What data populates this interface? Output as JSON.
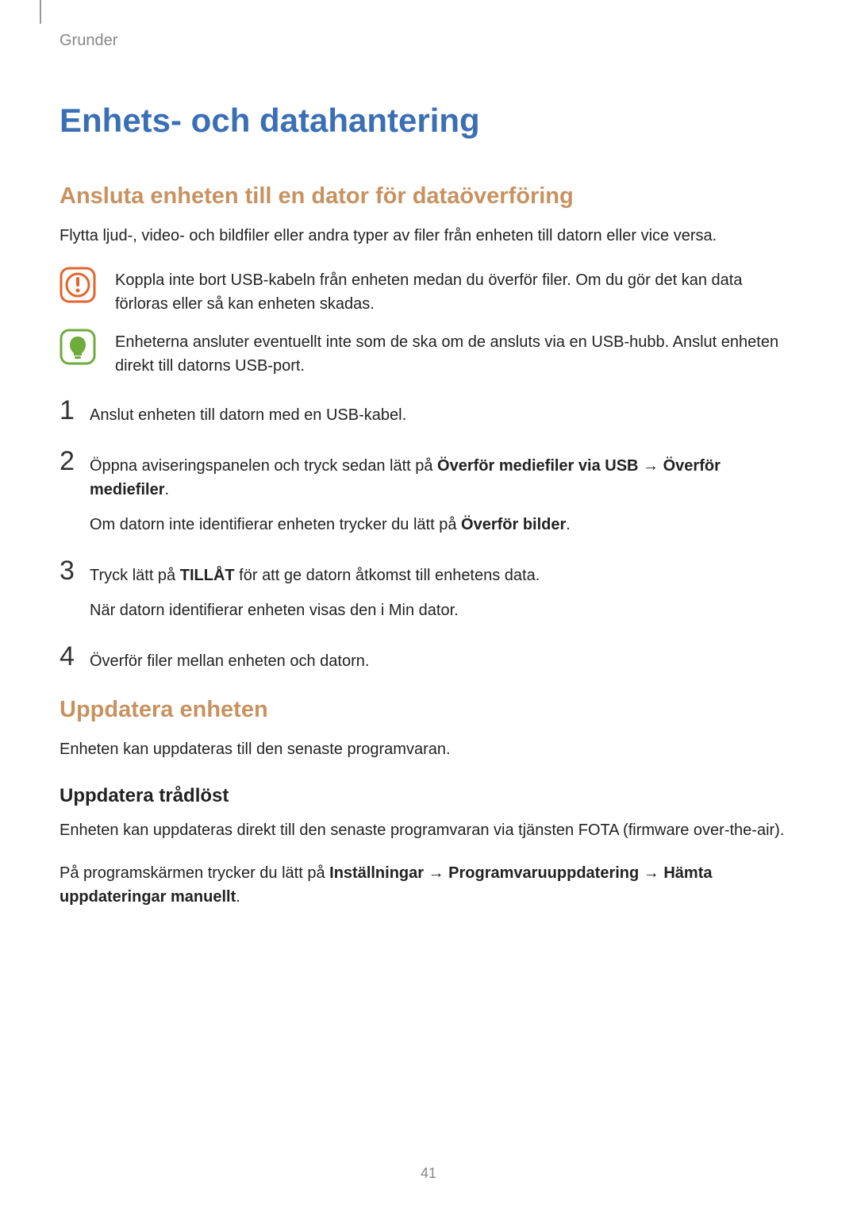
{
  "breadcrumb": "Grunder",
  "h1": "Enhets- och datahantering",
  "section1": {
    "title": "Ansluta enheten till en dator för dataöverföring",
    "intro": "Flytta ljud-, video- och bildfiler eller andra typer av filer från enheten till datorn eller vice versa.",
    "alert_warning": "Koppla inte bort USB-kabeln från enheten medan du överför filer. Om du gör det kan data förloras eller så kan enheten skadas.",
    "alert_info": "Enheterna ansluter eventuellt inte som de ska om de ansluts via en USB-hubb. Anslut enheten direkt till datorns USB-port.",
    "steps": {
      "n1": "1",
      "s1": "Anslut enheten till datorn med en USB-kabel.",
      "n2": "2",
      "s2_a": "Öppna aviseringspanelen och tryck sedan lätt på ",
      "s2_b": "Överför mediefiler via USB",
      "s2_arrow": " → ",
      "s2_c": "Överför mediefiler",
      "s2_d": ".",
      "s2_sub_a": "Om datorn inte identifierar enheten trycker du lätt på ",
      "s2_sub_b": "Överför bilder",
      "s2_sub_c": ".",
      "n3": "3",
      "s3_a": "Tryck lätt på ",
      "s3_b": "TILLÅT",
      "s3_c": " för att ge datorn åtkomst till enhetens data.",
      "s3_sub": "När datorn identifierar enheten visas den i Min dator.",
      "n4": "4",
      "s4": "Överför filer mellan enheten och datorn."
    }
  },
  "section2": {
    "title": "Uppdatera enheten",
    "intro": "Enheten kan uppdateras till den senaste programvaran.",
    "sub_title": "Uppdatera trådlöst",
    "p1": "Enheten kan uppdateras direkt till den senaste programvaran via tjänsten FOTA (firmware over-the-air).",
    "p2_a": "På programskärmen trycker du lätt på ",
    "p2_b": "Inställningar",
    "p2_arrow1": " → ",
    "p2_c": "Programvaruuppdatering",
    "p2_arrow2": " → ",
    "p2_d": "Hämta uppdateringar manuellt",
    "p2_e": "."
  },
  "page_number": "41"
}
